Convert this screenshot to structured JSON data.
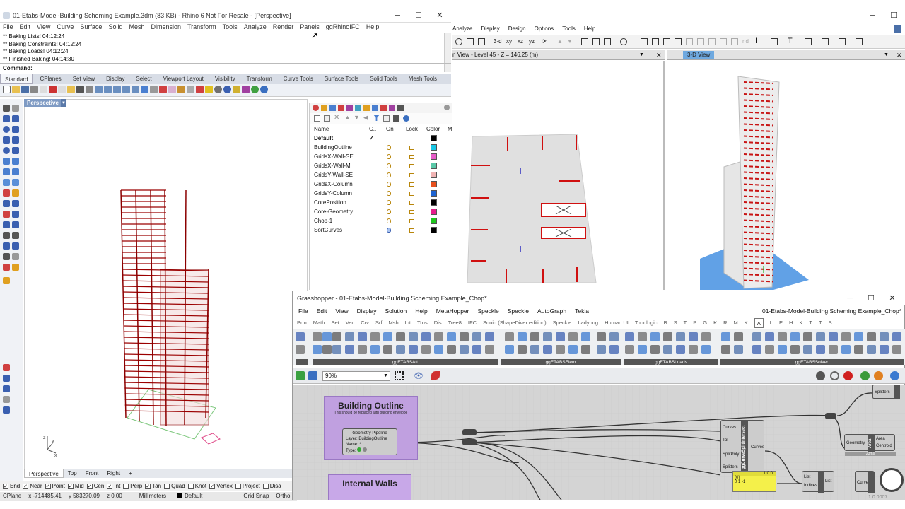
{
  "rhino": {
    "title": "01-Etabs-Model-Building Scheming Example.3dm (83 KB) - Rhino 6 Not For Resale - [Perspective]",
    "menu": [
      "File",
      "Edit",
      "View",
      "Curve",
      "Surface",
      "Solid",
      "Mesh",
      "Dimension",
      "Transform",
      "Tools",
      "Analyze",
      "Render",
      "Panels",
      "ggRhinoIFC",
      "Help"
    ],
    "history": [
      "** Baking Lists! 04:12:24",
      "** Baking Constraints! 04:12:24",
      "** Baking Loads! 04:12:24",
      "** Finished Baking! 04:14:30"
    ],
    "command_label": "Command:",
    "toolbar_tabs": [
      "Standard",
      "CPlanes",
      "Set View",
      "Display",
      "Select",
      "Viewport Layout",
      "Visibility",
      "Transform",
      "Curve Tools",
      "Surface Tools",
      "Solid Tools",
      "Mesh Tools"
    ],
    "viewport_label": "Perspective",
    "view_tabs": [
      "Perspective",
      "Top",
      "Front",
      "Right",
      "+"
    ],
    "osnaps": [
      {
        "label": "End",
        "checked": true
      },
      {
        "label": "Near",
        "checked": true
      },
      {
        "label": "Point",
        "checked": true
      },
      {
        "label": "Mid",
        "checked": true
      },
      {
        "label": "Cen",
        "checked": true
      },
      {
        "label": "Int",
        "checked": true
      },
      {
        "label": "Perp",
        "checked": false
      },
      {
        "label": "Tan",
        "checked": true
      },
      {
        "label": "Quad",
        "checked": false
      },
      {
        "label": "Knot",
        "checked": false
      },
      {
        "label": "Vertex",
        "checked": true
      },
      {
        "label": "Project",
        "checked": false
      },
      {
        "label": "Disa",
        "checked": false
      }
    ],
    "status": {
      "cplane": "CPlane",
      "x": "x -714485.41",
      "y": "y 583270.09",
      "z": "z 0.00",
      "units": "Millimeters",
      "layer": "Default",
      "grid_snap": "Grid Snap",
      "ortho": "Ortho"
    }
  },
  "layers": {
    "headers": {
      "name": "Name",
      "current": "C..",
      "on": "On",
      "lock": "Lock",
      "color": "Color",
      "material": "M"
    },
    "rows": [
      {
        "name": "Default",
        "current": true,
        "color": "#000000"
      },
      {
        "name": "BuildingOutline",
        "current": false,
        "color": "#19c8e6"
      },
      {
        "name": "GridsX-Wall-SE",
        "current": false,
        "color": "#e65ac8"
      },
      {
        "name": "GridsX-Wall-M",
        "current": false,
        "color": "#5ac8a8"
      },
      {
        "name": "GridsY-Wall-SE",
        "current": false,
        "color": "#f0b4b4"
      },
      {
        "name": "GridsX-Column",
        "current": false,
        "color": "#e6501e"
      },
      {
        "name": "GridsY-Column",
        "current": false,
        "color": "#1e64d2"
      },
      {
        "name": "CorePosition",
        "current": false,
        "color": "#000000"
      },
      {
        "name": "Core-Geometry",
        "current": false,
        "color": "#e61e8c"
      },
      {
        "name": "Chop-1",
        "current": false,
        "color": "#1ec81e"
      },
      {
        "name": "SortCurves",
        "current": false,
        "color": "#000000"
      }
    ]
  },
  "etabs": {
    "menu": [
      "Analyze",
      "Display",
      "Design",
      "Options",
      "Tools",
      "Help"
    ],
    "plan_title": "n View - Level 45 - Z = 146.25 (m)",
    "view3d_title": "3-D View"
  },
  "gh": {
    "title": "Grasshopper - 01-Etabs-Model-Building Scheming Example_Chop*",
    "doc_name": "01-Etabs-Model-Building Scheming Example_Chop*",
    "menu": [
      "File",
      "Edit",
      "View",
      "Display",
      "Solution",
      "Help",
      "MetaHopper",
      "Speckle",
      "Speckle",
      "AutoGraph",
      "Tekla"
    ],
    "tabs": [
      "Prm",
      "Math",
      "Set",
      "Vec",
      "Crv",
      "Srf",
      "Msh",
      "Int",
      "Trns",
      "Dis",
      "Tree8",
      "IFC",
      "Squid (ShapeDiver edition)",
      "Speckle",
      "Ladybug",
      "Human UI",
      "Topologic",
      "B",
      "S",
      "T",
      "P",
      "G",
      "K",
      "R",
      "M",
      "K",
      "A",
      "L",
      "E",
      "H",
      "K",
      "T",
      "T",
      "S"
    ],
    "active_tab_index": 26,
    "ribbon_sections": [
      "ggETABSAtt",
      "ggETABSElem",
      "ggETABSLoads",
      "ggETABSSolver"
    ],
    "zoom": "90%",
    "groups": {
      "building_outline_title": "Building Outline",
      "building_outline_note": "This should be replaced with building envelope",
      "internal_walls_title": "Internal Walls"
    },
    "geometry_pipeline": {
      "title": "Geometry Pipeline",
      "layer": "Layer:  BuildingOutline",
      "name": "Name:  *",
      "type": "Type:"
    },
    "split_component": {
      "name": "ggCurveSplitIntersect",
      "inputs": [
        "Curves",
        "Tol",
        "SplitPoly",
        "Splitters"
      ],
      "output": "Curves"
    },
    "area_component": {
      "name": "Area",
      "input": "Geometry",
      "outputs": [
        "Area",
        "Centroid"
      ],
      "footer": "23ms"
    },
    "splitters_label": "Splitters",
    "panel_label": "{0}",
    "panel_value": "0 1 -1",
    "panel_counter": "1 0 0",
    "list_component": {
      "title": "List",
      "inputs": [
        "List",
        "Indices"
      ],
      "output": "List"
    },
    "curve_label": "Curve",
    "version": "1.0.0007"
  }
}
